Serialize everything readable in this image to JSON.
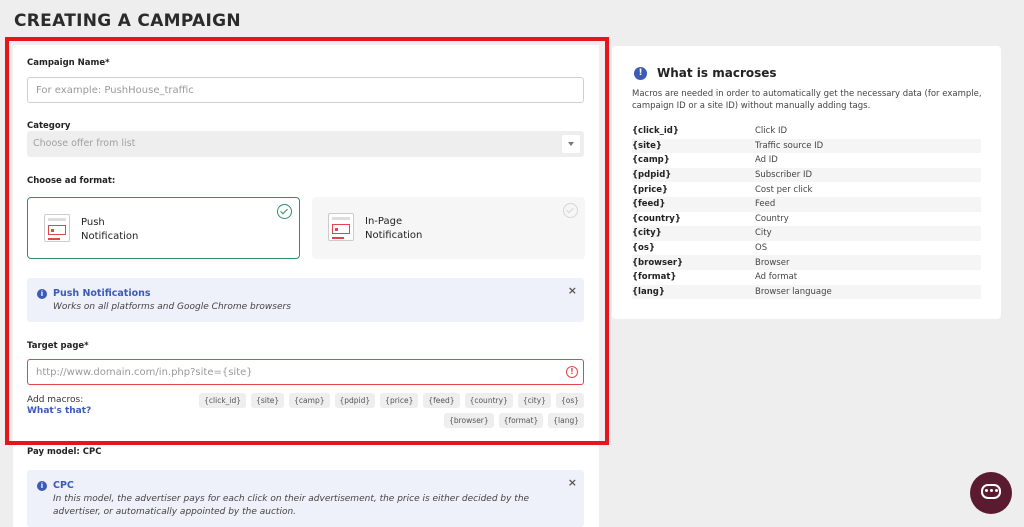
{
  "page": {
    "title": "CREATING A CAMPAIGN"
  },
  "form": {
    "campaign_name": {
      "label": "Campaign Name*",
      "placeholder": "For example: PushHouse_traffic",
      "value": ""
    },
    "category": {
      "label": "Category",
      "placeholder": "Choose offer from list"
    },
    "ad_format": {
      "label": "Choose ad format:",
      "options": [
        {
          "name": "push",
          "line1": "Push",
          "line2": "Notification",
          "selected": true
        },
        {
          "name": "in-page",
          "line1": "In-Page",
          "line2": "Notification",
          "selected": false
        }
      ]
    },
    "push_info": {
      "icon": "info-icon",
      "title": "Push Notifications",
      "desc": "Works on all platforms and Google Chrome browsers",
      "close": "×"
    },
    "target_page": {
      "label": "Target page*",
      "placeholder": "http://www.domain.com/in.php?site={site}",
      "value": "",
      "error_icon": "!"
    },
    "add_macros": {
      "label": "Add macros:",
      "link": "What's that?",
      "chips": [
        "{click_id}",
        "{site}",
        "{camp}",
        "{pdpid}",
        "{price}",
        "{feed}",
        "{country}",
        "{city}",
        "{os}",
        "{browser}",
        "{format}",
        "{lang}"
      ]
    },
    "pay_model": {
      "label": "Pay model: CPC"
    },
    "cpc_info": {
      "icon": "info-icon",
      "title": "CPC",
      "desc": "In this model, the advertiser pays for each click on their advertisement, the price is either decided by the advertiser, or automatically appointed by the auction.",
      "close": "×"
    }
  },
  "macros_panel": {
    "title": "What is macroses",
    "desc": "Macros are needed in order to automatically get the necessary data (for example, campaign ID or a site ID) without manually adding tags.",
    "rows": [
      {
        "key": "{click_id}",
        "value": "Click ID"
      },
      {
        "key": "{site}",
        "value": "Traffic source ID"
      },
      {
        "key": "{camp}",
        "value": "Ad ID"
      },
      {
        "key": "{pdpid}",
        "value": "Subscriber ID"
      },
      {
        "key": "{price}",
        "value": "Cost per click"
      },
      {
        "key": "{feed}",
        "value": "Feed"
      },
      {
        "key": "{country}",
        "value": "Country"
      },
      {
        "key": "{city}",
        "value": "City"
      },
      {
        "key": "{os}",
        "value": "OS"
      },
      {
        "key": "{browser}",
        "value": "Browser"
      },
      {
        "key": "{format}",
        "value": "Ad format"
      },
      {
        "key": "{lang}",
        "value": "Browser language"
      }
    ]
  },
  "colors": {
    "accent": "#3c5bb5",
    "selected": "#2e8f66",
    "error": "#e0464b",
    "highlight_frame": "#e8141b",
    "chat": "#5a1b30"
  }
}
